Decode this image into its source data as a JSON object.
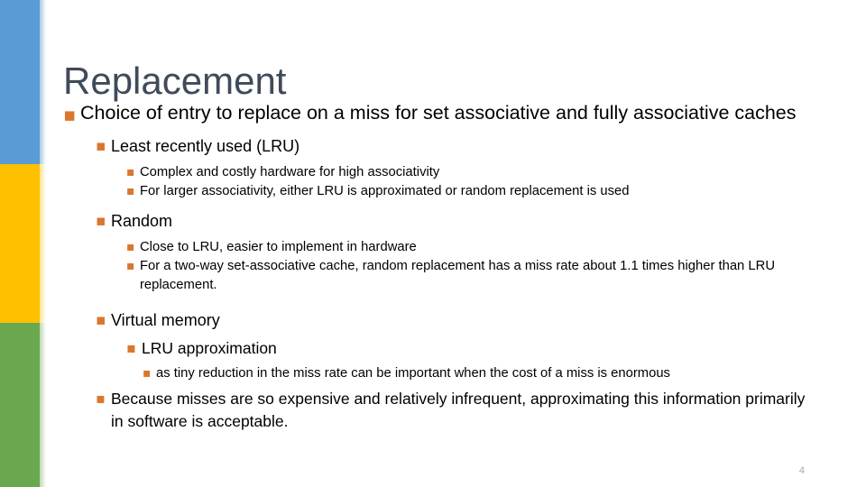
{
  "slide": {
    "title": "Replacement",
    "page_number": "4",
    "bullet_glyph": "▪",
    "colors": {
      "accent_blue": "#5b9bd5",
      "accent_yellow": "#ffc000",
      "accent_green": "#6aa84f",
      "bullet_orange": "#d9772e",
      "title_text": "#3f4a5a",
      "body_text": "#000000",
      "page_number_text": "#a6a6a6"
    },
    "sidebar": {
      "segments": [
        {
          "name": "blue-segment",
          "color": "#5b9bd5"
        },
        {
          "name": "yellow-segment",
          "color": "#ffc000"
        },
        {
          "name": "green-segment",
          "color": "#6aa84f"
        }
      ]
    },
    "bullets": {
      "b1": "Choice of entry to replace on a miss for set associative and fully associative caches",
      "b2": "Least recently used (LRU)",
      "b3": "Complex and costly hardware for high associativity",
      "b4": "For larger associativity, either LRU is approximated or random replacement is used",
      "b5": "Random",
      "b6": "Close to LRU, easier to implement in hardware",
      "b7": "For a two-way set-associative cache, random replacement has a miss rate about 1.1 times higher than LRU replacement.",
      "b8": "Virtual memory",
      "b9": "LRU approximation",
      "b10": "as tiny reduction in the miss rate can be important when the cost of a miss is enormous",
      "b11": "Because misses are so expensive and relatively infrequent, approximating this information primarily in software is acceptable."
    }
  }
}
